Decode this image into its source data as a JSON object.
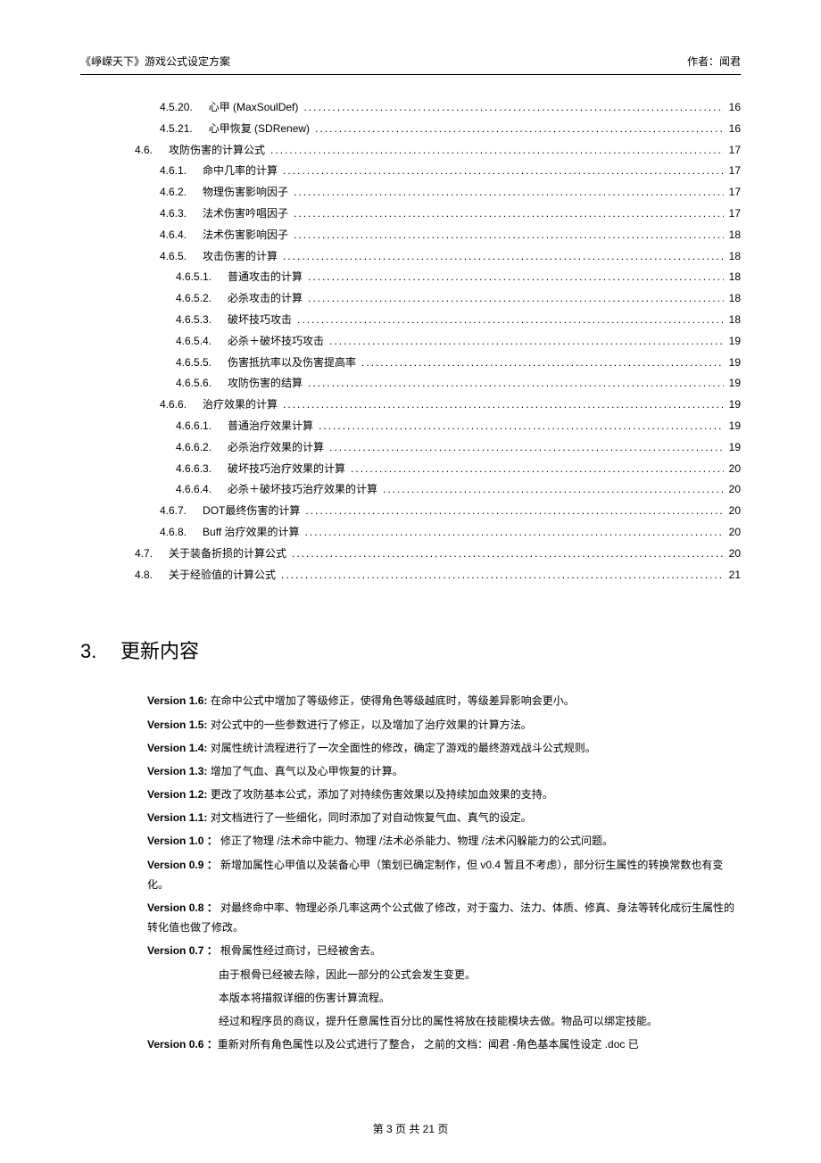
{
  "header": {
    "left": "《崢嵘天下》游戏公式设定方案",
    "right": "作者：闻君"
  },
  "toc": [
    {
      "indent": 1,
      "num": "4.5.20.",
      "title": "心甲 (MaxSoulDef)",
      "page": "16"
    },
    {
      "indent": 1,
      "num": "4.5.21.",
      "title": "心甲恢复 (SDRenew)",
      "page": "16"
    },
    {
      "indent": 0,
      "num": "4.6.",
      "title": "攻防伤害的计算公式",
      "page": "17"
    },
    {
      "indent": 1,
      "num": "4.6.1.",
      "title": "命中几率的计算",
      "page": "17"
    },
    {
      "indent": 1,
      "num": "4.6.2.",
      "title": "物理伤害影响因子",
      "page": "17"
    },
    {
      "indent": 1,
      "num": "4.6.3.",
      "title": "法术伤害吟唱因子",
      "page": "17"
    },
    {
      "indent": 1,
      "num": "4.6.4.",
      "title": "法术伤害影响因子",
      "page": "18"
    },
    {
      "indent": 1,
      "num": "4.6.5.",
      "title": "攻击伤害的计算",
      "page": "18"
    },
    {
      "indent": 2,
      "num": "4.6.5.1.",
      "title": "普通攻击的计算",
      "page": "18"
    },
    {
      "indent": 2,
      "num": "4.6.5.2.",
      "title": "必杀攻击的计算",
      "page": "18"
    },
    {
      "indent": 2,
      "num": "4.6.5.3.",
      "title": "破坏技巧攻击",
      "page": "18"
    },
    {
      "indent": 2,
      "num": "4.6.5.4.",
      "title": "必杀＋破坏技巧攻击",
      "page": "19"
    },
    {
      "indent": 2,
      "num": "4.6.5.5.",
      "title": "伤害抵抗率以及伤害提高率",
      "page": "19"
    },
    {
      "indent": 2,
      "num": "4.6.5.6.",
      "title": "攻防伤害的结算",
      "page": "19"
    },
    {
      "indent": 1,
      "num": "4.6.6.",
      "title": "治疗效果的计算",
      "page": "19"
    },
    {
      "indent": 2,
      "num": "4.6.6.1.",
      "title": "普通治疗效果计算",
      "page": "19"
    },
    {
      "indent": 2,
      "num": "4.6.6.2.",
      "title": "必杀治疗效果的计算",
      "page": "19"
    },
    {
      "indent": 2,
      "num": "4.6.6.3.",
      "title": "破坏技巧治疗效果的计算",
      "page": "20"
    },
    {
      "indent": 2,
      "num": "4.6.6.4.",
      "title": "必杀＋破坏技巧治疗效果的计算",
      "page": "20"
    },
    {
      "indent": 1,
      "num": "4.6.7.",
      "title": "DOT最终伤害的计算",
      "page": "20"
    },
    {
      "indent": 1,
      "num": "4.6.8.",
      "title": "Buff 治疗效果的计算",
      "page": "20"
    },
    {
      "indent": 0,
      "num": "4.7.",
      "title": "关于装备折损的计算公式",
      "page": "20"
    },
    {
      "indent": 0,
      "num": "4.8.",
      "title": "关于经验值的计算公式",
      "page": "21"
    }
  ],
  "update_section": {
    "num": "3.",
    "title": "更新内容"
  },
  "versions": [
    {
      "label": "Version 1.6:",
      "text": "在命中公式中增加了等级修正，使得角色等级越底时，等级差异影响会更小。"
    },
    {
      "label": "Version 1.5:",
      "text": "对公式中的一些参数进行了修正，以及增加了治疗效果的计算方法。"
    },
    {
      "label": "Version 1.4:",
      "text": "对属性统计流程进行了一次全面性的修改，确定了游戏的最终游戏战斗公式规则。"
    },
    {
      "label": "Version 1.3:",
      "text": "增加了气血、真气以及心甲恢复的计算。"
    },
    {
      "label": "Version 1.2:",
      "text": "更改了攻防基本公式，添加了对持续伤害效果以及持续加血效果的支持。"
    },
    {
      "label": "Version 1.1:",
      "text": "对文档进行了一些细化，同时添加了对自动恢复气血、真气的设定。"
    },
    {
      "label": "Version 1.0  ：",
      "text": "修正了物理 /法术命中能力、物理  /法术必杀能力、物理  /法术闪躲能力的公式问题。"
    },
    {
      "label": "Version 0.9 ：",
      "text": "新增加属性心甲值以及装备心甲（策划已确定制作，但    v0.4 暂且不考虑），部分衍生属性的转换常数也有变化。"
    },
    {
      "label": "Version 0.8 ：",
      "text": "对最终命中率、物理必杀几率这两个公式做了修改，对于蛮力、法力、体质、修真、身法等转化成衍生属性的转化值也做了修改。"
    },
    {
      "label": "Version 0.7 ：",
      "text": "根骨属性经过商讨，已经被舍去。"
    }
  ],
  "v07_extra": [
    "由于根骨已经被去除，因此一部分的公式会发生变更。",
    "本版本将描叙详细的伤害计算流程。",
    "经过和程序员的商议，提升任意属性百分比的属性将放在技能模块去做。物品可以绑定技能。"
  ],
  "v06": {
    "label": "Version 0.6 ：",
    "text": "重新对所有角色属性以及公式进行了整合，   之前的文档：闻君 -角色基本属性设定  .doc  已"
  },
  "footer": "第 3 页 共 21 页"
}
